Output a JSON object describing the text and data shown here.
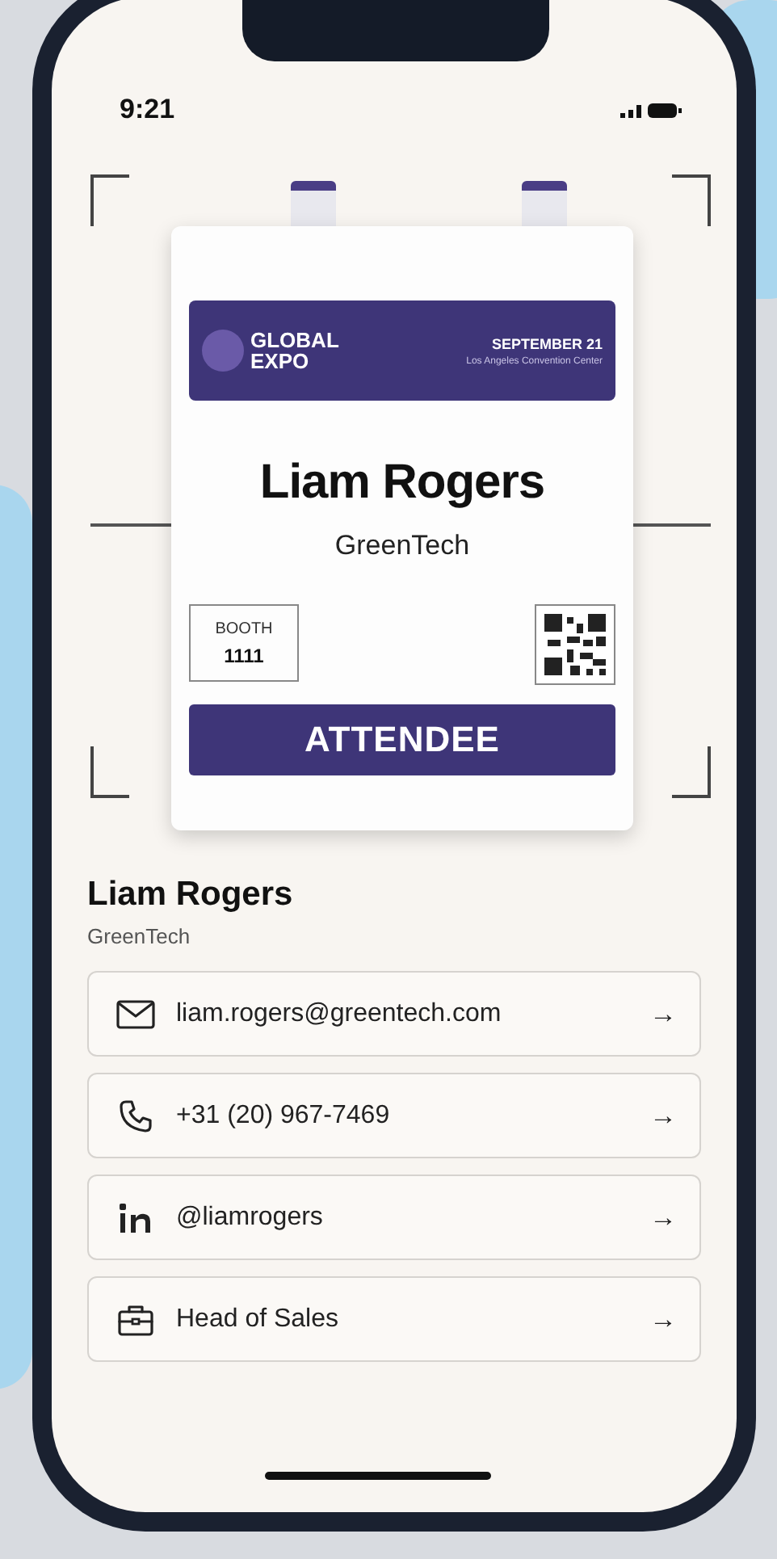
{
  "status_bar": {
    "time": "9:21"
  },
  "badge": {
    "event_name": "GLOBAL EXPO",
    "date": "SEPTEMBER 21",
    "venue": "Los Angeles Convention Center",
    "name": "Liam Rogers",
    "company": "GreenTech",
    "booth_label": "BOOTH",
    "booth_number": "1111",
    "role": "ATTENDEE"
  },
  "profile": {
    "name": "Liam Rogers",
    "company": "GreenTech"
  },
  "contacts": [
    {
      "kind": "email",
      "value": "liam.rogers@greentech.com",
      "arrow": "→"
    },
    {
      "kind": "phone",
      "value": "+31 (20) 967-7469",
      "arrow": "→"
    },
    {
      "kind": "linkedin",
      "value": "@liamrogers",
      "arrow": "→"
    },
    {
      "kind": "job",
      "value": "Head of Sales",
      "arrow": "→"
    }
  ]
}
